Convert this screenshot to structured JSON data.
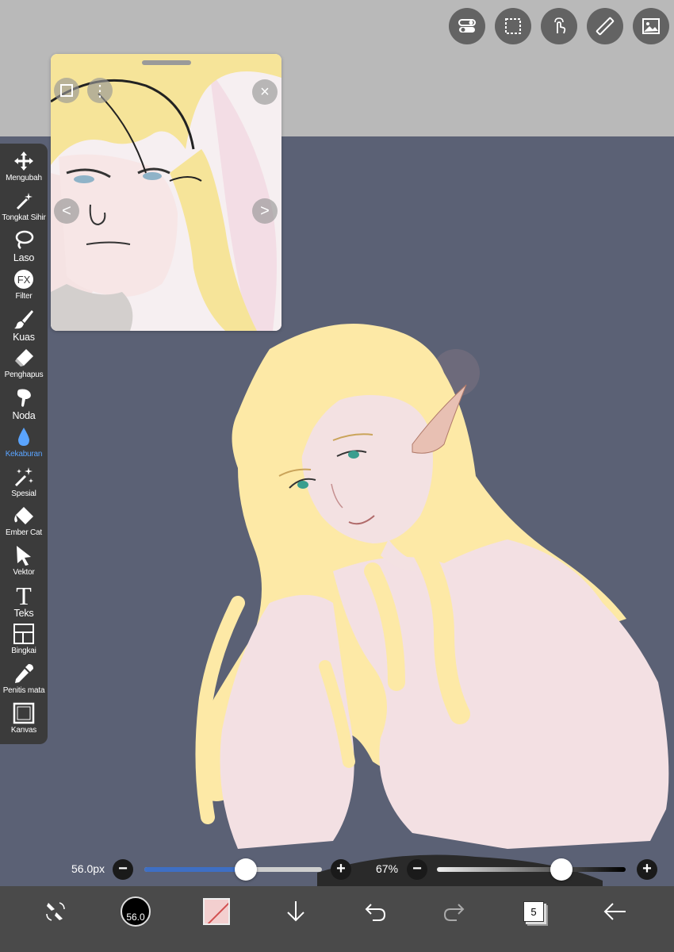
{
  "top_tools": [
    {
      "name": "toggle-settings-icon"
    },
    {
      "name": "selection-icon"
    },
    {
      "name": "touch-gesture-icon"
    },
    {
      "name": "ruler-icon"
    },
    {
      "name": "reference-image-icon"
    }
  ],
  "reference_window": {
    "prev_icon": "<",
    "next_icon": ">",
    "close_icon": "×",
    "menu_icon": "⋮"
  },
  "toolbar": {
    "tools": [
      {
        "label": "Mengubah",
        "icon": "move-icon"
      },
      {
        "label": "Tongkat Sihir",
        "icon": "magic-wand-icon"
      },
      {
        "label": "Laso",
        "icon": "lasso-icon"
      },
      {
        "label": "Filter",
        "icon": "fx-icon"
      },
      {
        "label": "Kuas",
        "icon": "brush-icon"
      },
      {
        "label": "Penghapus",
        "icon": "eraser-icon"
      },
      {
        "label": "Noda",
        "icon": "smudge-icon"
      },
      {
        "label": "Kekaburan",
        "icon": "blur-drop-icon"
      },
      {
        "label": "Spesial",
        "icon": "sparkle-icon"
      },
      {
        "label": "Ember Cat",
        "icon": "paint-bucket-icon"
      },
      {
        "label": "Vektor",
        "icon": "vector-arrow-icon"
      },
      {
        "label": "Teks",
        "icon": "text-icon"
      },
      {
        "label": "Bingkai",
        "icon": "frame-icon"
      },
      {
        "label": "Penitis mata",
        "icon": "eyedropper-icon"
      },
      {
        "label": "Kanvas",
        "icon": "canvas-icon"
      }
    ],
    "active_tool": "Kekaburan"
  },
  "sliders": {
    "size": {
      "value": "56.0px",
      "level": 0.57
    },
    "opacity": {
      "value": "67%",
      "level": 0.66
    },
    "minus": "−",
    "plus": "+"
  },
  "bottom_bar": {
    "brush_size": "56.0",
    "layer_count": "5",
    "primary_color": "#f3cfcf"
  },
  "colors": {
    "canvas_bg": "#5b6175",
    "hair": "#fde9a6",
    "skin": "#f3e1e2",
    "shirt": "#f3e0e3",
    "accent": "#5aa4ff"
  }
}
